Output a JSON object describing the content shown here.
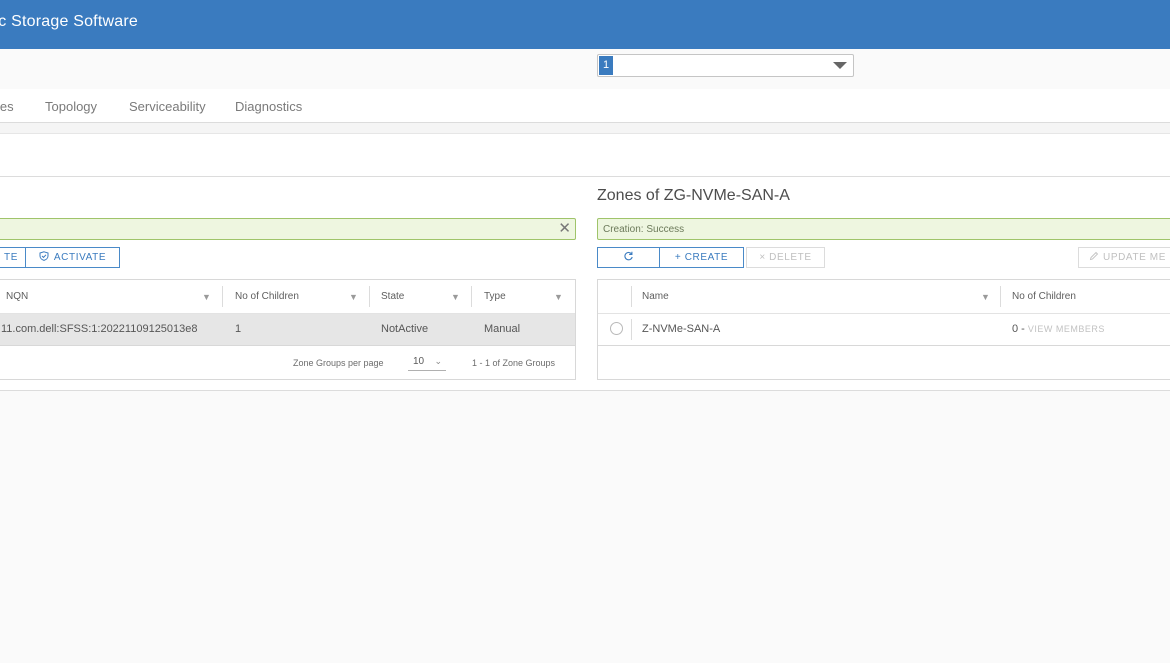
{
  "header": {
    "title": "ric Storage Software"
  },
  "topbar": {
    "select_value": "1"
  },
  "tabs": [
    "ies",
    "Topology",
    "Serviceability",
    "Diagnostics"
  ],
  "left": {
    "toolbar": {
      "partial_label": "TE",
      "activate_label": "ACTIVATE",
      "activate_icon": "shield-check-icon"
    },
    "columns": [
      "NQN",
      "No of Children",
      "State",
      "Type"
    ],
    "rows": [
      {
        "nqn": "11.com.dell:SFSS:1:20221109125013e8",
        "children": "1",
        "state": "NotActive",
        "type": "Manual"
      }
    ],
    "footer": {
      "per_page_label": "Zone Groups per page",
      "per_page_value": "10",
      "range": "1 - 1 of Zone Groups"
    }
  },
  "right": {
    "title": "Zones of ZG-NVMe-SAN-A",
    "alert": "Creation: Success",
    "toolbar": {
      "create_label": "+ CREATE",
      "delete_label": "× DELETE",
      "update_label": "UPDATE ME"
    },
    "columns": [
      "Name",
      "No of Children"
    ],
    "rows": [
      {
        "name": "Z-NVMe-SAN-A",
        "children": "0 -",
        "action": "VIEW MEMBERS"
      }
    ]
  },
  "colors": {
    "header_bg": "#3a7bbf",
    "accent": "#3a7bbf",
    "success_bg": "#eef6e0",
    "success_border": "#9fc46a"
  }
}
